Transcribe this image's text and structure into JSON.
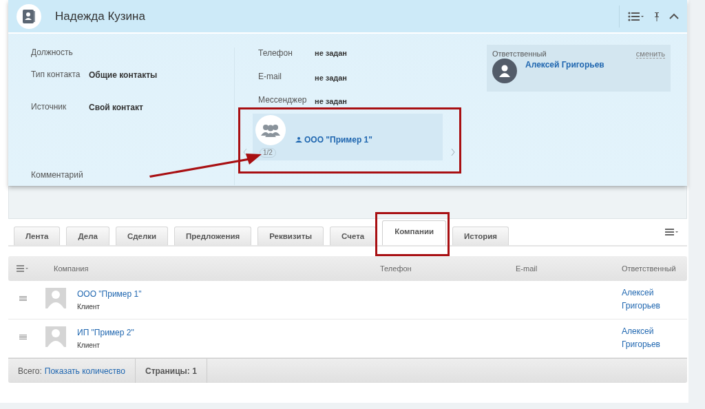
{
  "header": {
    "title": "Надежда Кузина"
  },
  "fields_left": [
    {
      "label": "Должность"
    },
    {
      "label": "Тип контакта",
      "value": "Общие контакты"
    },
    {
      "label": "Источник",
      "value": "Свой контакт"
    }
  ],
  "comment_label": "Комментарий",
  "fields_middle": [
    {
      "label": "Телефон",
      "value": "не задан"
    },
    {
      "label": "E-mail",
      "value": "не задан"
    },
    {
      "label": "Мессенджер",
      "value": "не задан"
    }
  ],
  "company_card": {
    "name": "ООО \"Пример 1\"",
    "pager": "1/2"
  },
  "responsible": {
    "label": "Ответственный",
    "action": "сменить",
    "name": "Алексей Григорьев"
  },
  "tabs": [
    {
      "label": "Лента",
      "selected": false
    },
    {
      "label": "Дела",
      "selected": false
    },
    {
      "label": "Сделки",
      "selected": false
    },
    {
      "label": "Предложения",
      "selected": false
    },
    {
      "label": "Реквизиты",
      "selected": false
    },
    {
      "label": "Счета",
      "selected": false
    },
    {
      "label": "Компании",
      "selected": true
    },
    {
      "label": "История",
      "selected": false
    }
  ],
  "table": {
    "columns": [
      "Компания",
      "Телефон",
      "E-mail",
      "Ответственный"
    ],
    "rows": [
      {
        "name": "ООО \"Пример 1\"",
        "type": "Клиент",
        "responsible": "Алексей Григорьев"
      },
      {
        "name": "ИП \"Пример 2\"",
        "type": "Клиент",
        "responsible": "Алексей Григорьев"
      }
    ]
  },
  "footer": {
    "total_label": "Всего:",
    "total_link": "Показать количество",
    "pages": "Страницы: 1"
  },
  "annotations": [
    {
      "kind": "box"
    },
    {
      "kind": "box"
    },
    {
      "kind": "arrow"
    }
  ]
}
